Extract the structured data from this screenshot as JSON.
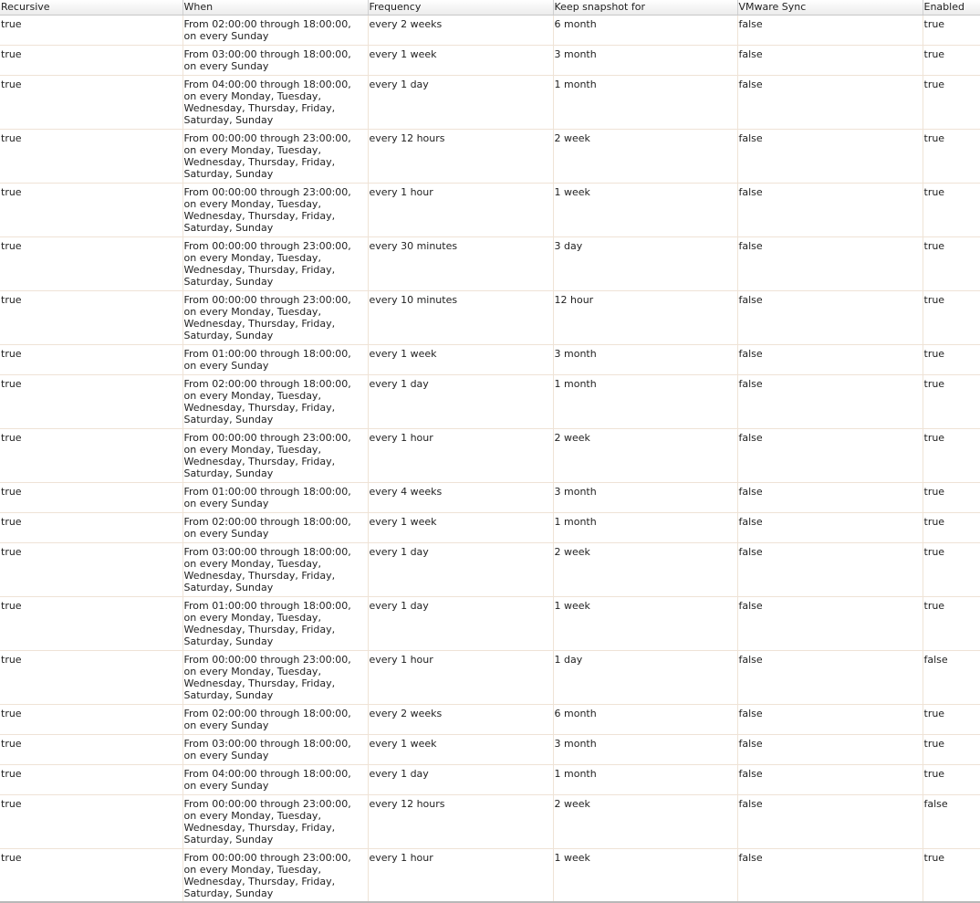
{
  "table": {
    "columns": [
      "Recursive",
      "When",
      "Frequency",
      "Keep snapshot for",
      "VMware Sync",
      "Enabled"
    ],
    "rows": [
      {
        "recursive": "true",
        "when": "From 02:00:00 through 18:00:00, on every Sunday",
        "frequency": "every 2 weeks",
        "keep": "6 month",
        "vmware_sync": "false",
        "enabled": "true"
      },
      {
        "recursive": "true",
        "when": "From 03:00:00 through 18:00:00, on every Sunday",
        "frequency": "every 1 week",
        "keep": "3 month",
        "vmware_sync": "false",
        "enabled": "true"
      },
      {
        "recursive": "true",
        "when": "From 04:00:00 through 18:00:00, on every Monday, Tuesday, Wednesday, Thursday, Friday, Saturday, Sunday",
        "frequency": "every 1 day",
        "keep": "1 month",
        "vmware_sync": "false",
        "enabled": "true"
      },
      {
        "recursive": "true",
        "when": "From 00:00:00 through 23:00:00, on every Monday, Tuesday, Wednesday, Thursday, Friday, Saturday, Sunday",
        "frequency": "every 12 hours",
        "keep": "2 week",
        "vmware_sync": "false",
        "enabled": "true"
      },
      {
        "recursive": "true",
        "when": "From 00:00:00 through 23:00:00, on every Monday, Tuesday, Wednesday, Thursday, Friday, Saturday, Sunday",
        "frequency": "every 1 hour",
        "keep": "1 week",
        "vmware_sync": "false",
        "enabled": "true"
      },
      {
        "recursive": "true",
        "when": "From 00:00:00 through 23:00:00, on every Monday, Tuesday, Wednesday, Thursday, Friday, Saturday, Sunday",
        "frequency": "every 30 minutes",
        "keep": "3 day",
        "vmware_sync": "false",
        "enabled": "true"
      },
      {
        "recursive": "true",
        "when": "From 00:00:00 through 23:00:00, on every Monday, Tuesday, Wednesday, Thursday, Friday, Saturday, Sunday",
        "frequency": "every 10 minutes",
        "keep": "12 hour",
        "vmware_sync": "false",
        "enabled": "true"
      },
      {
        "recursive": "true",
        "when": "From 01:00:00 through 18:00:00, on every Sunday",
        "frequency": "every 1 week",
        "keep": "3 month",
        "vmware_sync": "false",
        "enabled": "true"
      },
      {
        "recursive": "true",
        "when": "From 02:00:00 through 18:00:00, on every Monday, Tuesday, Wednesday, Thursday, Friday, Saturday, Sunday",
        "frequency": "every 1 day",
        "keep": "1 month",
        "vmware_sync": "false",
        "enabled": "true"
      },
      {
        "recursive": "true",
        "when": "From 00:00:00 through 23:00:00, on every Monday, Tuesday, Wednesday, Thursday, Friday, Saturday, Sunday",
        "frequency": "every 1 hour",
        "keep": "2 week",
        "vmware_sync": "false",
        "enabled": "true"
      },
      {
        "recursive": "true",
        "when": "From 01:00:00 through 18:00:00, on every Sunday",
        "frequency": "every 4 weeks",
        "keep": "3 month",
        "vmware_sync": "false",
        "enabled": "true"
      },
      {
        "recursive": "true",
        "when": "From 02:00:00 through 18:00:00, on every Sunday",
        "frequency": "every 1 week",
        "keep": "1 month",
        "vmware_sync": "false",
        "enabled": "true"
      },
      {
        "recursive": "true",
        "when": "From 03:00:00 through 18:00:00, on every Monday, Tuesday, Wednesday, Thursday, Friday, Saturday, Sunday",
        "frequency": "every 1 day",
        "keep": "2 week",
        "vmware_sync": "false",
        "enabled": "true"
      },
      {
        "recursive": "true",
        "when": "From 01:00:00 through 18:00:00, on every Monday, Tuesday, Wednesday, Thursday, Friday, Saturday, Sunday",
        "frequency": "every 1 day",
        "keep": "1 week",
        "vmware_sync": "false",
        "enabled": "true"
      },
      {
        "recursive": "true",
        "when": "From 00:00:00 through 23:00:00, on every Monday, Tuesday, Wednesday, Thursday, Friday, Saturday, Sunday",
        "frequency": "every 1 hour",
        "keep": "1 day",
        "vmware_sync": "false",
        "enabled": "false"
      },
      {
        "recursive": "true",
        "when": "From 02:00:00 through 18:00:00, on every Sunday",
        "frequency": "every 2 weeks",
        "keep": "6 month",
        "vmware_sync": "false",
        "enabled": "true"
      },
      {
        "recursive": "true",
        "when": "From 03:00:00 through 18:00:00, on every Sunday",
        "frequency": "every 1 week",
        "keep": "3 month",
        "vmware_sync": "false",
        "enabled": "true"
      },
      {
        "recursive": "true",
        "when": "From 04:00:00 through 18:00:00, on every Sunday",
        "frequency": "every 1 day",
        "keep": "1 month",
        "vmware_sync": "false",
        "enabled": "true"
      },
      {
        "recursive": "true",
        "when": "From 00:00:00 through 23:00:00, on every Monday, Tuesday, Wednesday, Thursday, Friday, Saturday, Sunday",
        "frequency": "every 12 hours",
        "keep": "2 week",
        "vmware_sync": "false",
        "enabled": "false"
      },
      {
        "recursive": "true",
        "when": "From 00:00:00 through 23:00:00, on every Monday, Tuesday, Wednesday, Thursday, Friday, Saturday, Sunday",
        "frequency": "every 1 hour",
        "keep": "1 week",
        "vmware_sync": "false",
        "enabled": "true"
      }
    ]
  }
}
